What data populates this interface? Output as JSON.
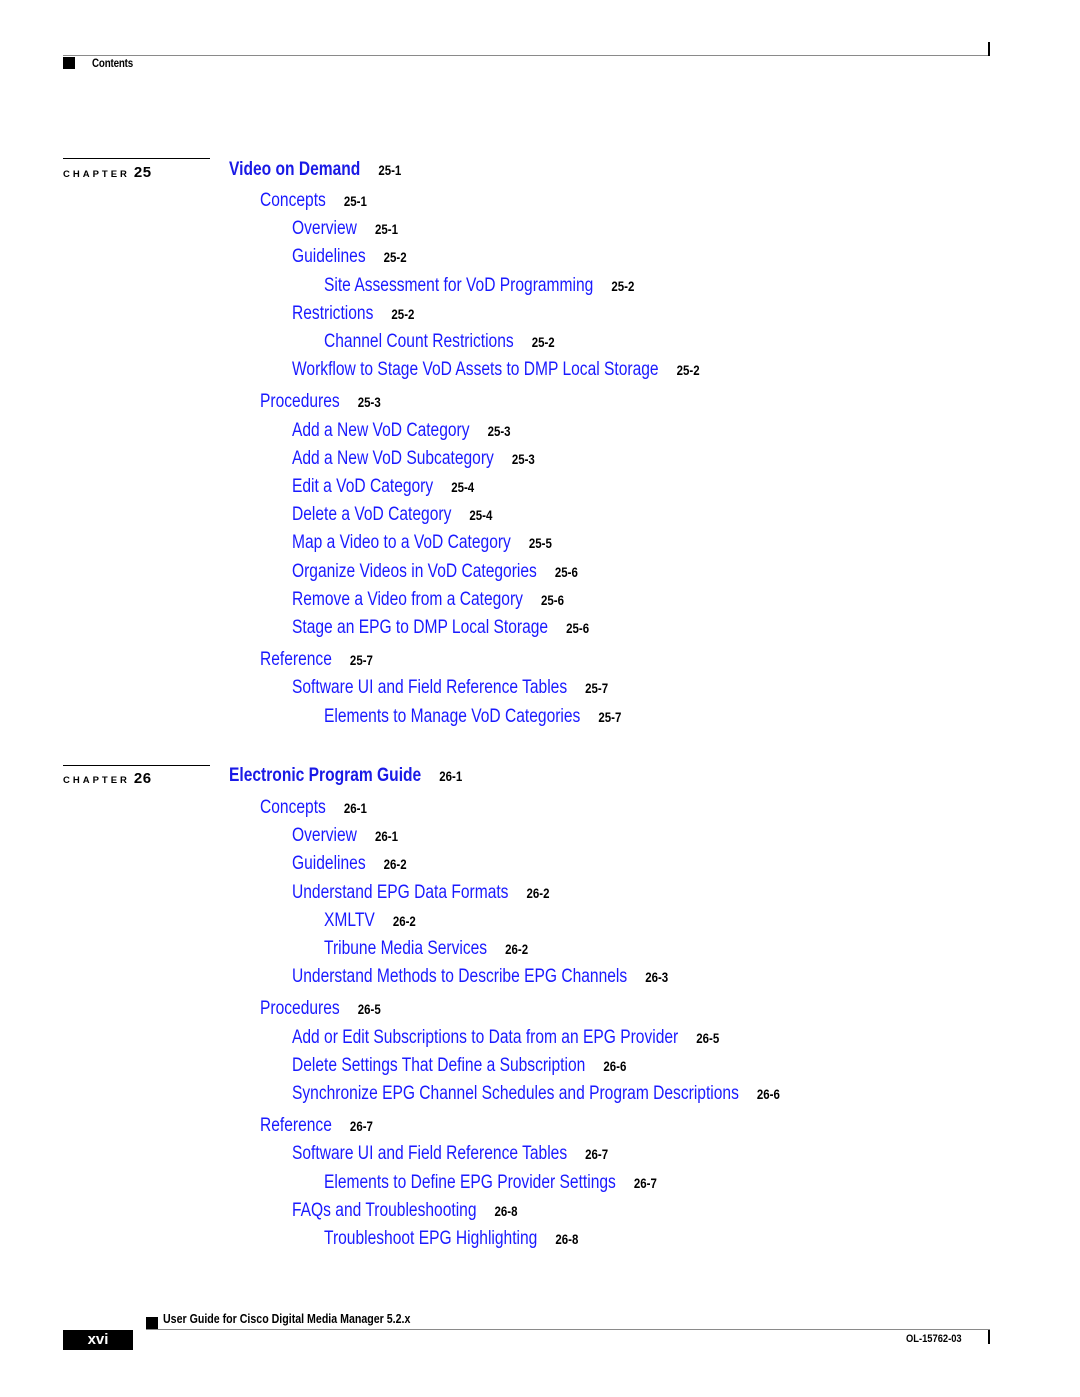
{
  "header": {
    "section_label": "Contents"
  },
  "chapters": [
    {
      "label": "CHAPTER",
      "number": "25",
      "title": "Video on Demand",
      "title_page": "25-1",
      "entries": [
        {
          "level": 1,
          "text": "Concepts",
          "page": "25-1"
        },
        {
          "level": 2,
          "text": "Overview",
          "page": "25-1"
        },
        {
          "level": 2,
          "text": "Guidelines",
          "page": "25-2"
        },
        {
          "level": 3,
          "text": "Site Assessment for VoD Programming",
          "page": "25-2"
        },
        {
          "level": 2,
          "text": "Restrictions",
          "page": "25-2"
        },
        {
          "level": 3,
          "text": "Channel Count Restrictions",
          "page": "25-2"
        },
        {
          "level": 2,
          "text": "Workflow to Stage VoD Assets to DMP Local Storage",
          "page": "25-2"
        },
        {
          "level": 1,
          "text": "Procedures",
          "page": "25-3"
        },
        {
          "level": 2,
          "text": "Add a New VoD Category",
          "page": "25-3"
        },
        {
          "level": 2,
          "text": "Add a New VoD Subcategory",
          "page": "25-3"
        },
        {
          "level": 2,
          "text": "Edit a VoD Category",
          "page": "25-4"
        },
        {
          "level": 2,
          "text": "Delete a VoD Category",
          "page": "25-4"
        },
        {
          "level": 2,
          "text": "Map a Video to a VoD Category",
          "page": "25-5"
        },
        {
          "level": 2,
          "text": "Organize Videos in VoD Categories",
          "page": "25-6"
        },
        {
          "level": 2,
          "text": "Remove a Video from a Category",
          "page": "25-6"
        },
        {
          "level": 2,
          "text": "Stage an EPG to DMP Local Storage",
          "page": "25-6"
        },
        {
          "level": 1,
          "text": "Reference",
          "page": "25-7"
        },
        {
          "level": 2,
          "text": "Software UI and Field Reference Tables",
          "page": "25-7"
        },
        {
          "level": 3,
          "text": "Elements to Manage VoD Categories",
          "page": "25-7"
        }
      ]
    },
    {
      "label": "CHAPTER",
      "number": "26",
      "title": "Electronic Program Guide",
      "title_page": "26-1",
      "entries": [
        {
          "level": 1,
          "text": "Concepts",
          "page": "26-1"
        },
        {
          "level": 2,
          "text": "Overview",
          "page": "26-1"
        },
        {
          "level": 2,
          "text": "Guidelines",
          "page": "26-2"
        },
        {
          "level": 2,
          "text": "Understand EPG Data Formats",
          "page": "26-2"
        },
        {
          "level": 3,
          "text": "XMLTV",
          "page": "26-2"
        },
        {
          "level": 3,
          "text": "Tribune Media Services",
          "page": "26-2"
        },
        {
          "level": 2,
          "text": "Understand Methods to Describe EPG Channels",
          "page": "26-3"
        },
        {
          "level": 1,
          "text": "Procedures",
          "page": "26-5"
        },
        {
          "level": 2,
          "text": "Add or Edit Subscriptions to Data from an EPG Provider",
          "page": "26-5"
        },
        {
          "level": 2,
          "text": "Delete Settings That Define a Subscription",
          "page": "26-6"
        },
        {
          "level": 2,
          "text": "Synchronize EPG Channel Schedules and Program Descriptions",
          "page": "26-6"
        },
        {
          "level": 1,
          "text": "Reference",
          "page": "26-7"
        },
        {
          "level": 2,
          "text": "Software UI and Field Reference Tables",
          "page": "26-7"
        },
        {
          "level": 3,
          "text": "Elements to Define EPG Provider Settings",
          "page": "26-7"
        },
        {
          "level": 2,
          "text": "FAQs and Troubleshooting",
          "page": "26-8"
        },
        {
          "level": 3,
          "text": "Troubleshoot EPG Highlighting",
          "page": "26-8"
        }
      ]
    }
  ],
  "footer": {
    "guide_title": "User Guide for Cisco Digital Media Manager 5.2.x",
    "page_number": "xvi",
    "doc_number": "OL-15762-03"
  },
  "colors": {
    "link": "#1a1aff",
    "title": "#1a1ae6",
    "text": "#000000"
  }
}
